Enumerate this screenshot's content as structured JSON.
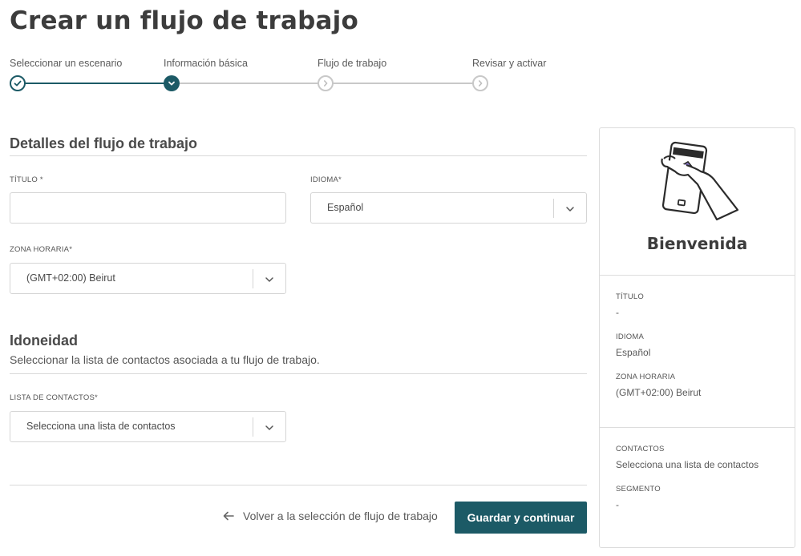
{
  "page": {
    "title": "Crear un flujo de trabajo"
  },
  "stepper": {
    "steps": [
      {
        "label": "Seleccionar un escenario",
        "state": "done"
      },
      {
        "label": "Información básica",
        "state": "current"
      },
      {
        "label": "Flujo de trabajo",
        "state": "pending"
      },
      {
        "label": "Revisar y activar",
        "state": "pending"
      }
    ]
  },
  "details": {
    "section_title": "Detalles del flujo de trabajo",
    "title_label": "TÍTULO *",
    "title_value": "",
    "language_label": "IDIOMA*",
    "language_value": "Español",
    "timezone_label": "ZONA HORARIA*",
    "timezone_value": "(GMT+02:00) Beirut"
  },
  "eligibility": {
    "section_title": "Idoneidad",
    "subtitle": "Seleccionar la lista de contactos asociada a tu flujo de trabajo.",
    "contacts_label": "LISTA DE CONTACTOS*",
    "contacts_placeholder": "Selecciona una lista de contactos"
  },
  "footer": {
    "back_label": "Volver a la selección de flujo de trabajo",
    "primary_label": "Guardar y continuar"
  },
  "summary": {
    "heading": "Bienvenida",
    "title_label": "TÍTULO",
    "title_value": "-",
    "language_label": "IDIOMA",
    "language_value": "Español",
    "timezone_label": "ZONA HORARIA",
    "timezone_value": "(GMT+02:00) Beirut",
    "contacts_label": "CONTACTOS",
    "contacts_value": "Selecciona una lista de contactos",
    "segment_label": "SEGMENTO",
    "segment_value": "-"
  },
  "colors": {
    "accent": "#1c5a66",
    "pending": "#c8c8c8",
    "illustration_accent": "#8e7bd6"
  },
  "icons": {
    "done": "check-icon",
    "current": "chevron-down-icon",
    "pending": "chevron-right-icon",
    "back": "arrow-left-icon",
    "dropdown": "chevron-down-icon"
  }
}
